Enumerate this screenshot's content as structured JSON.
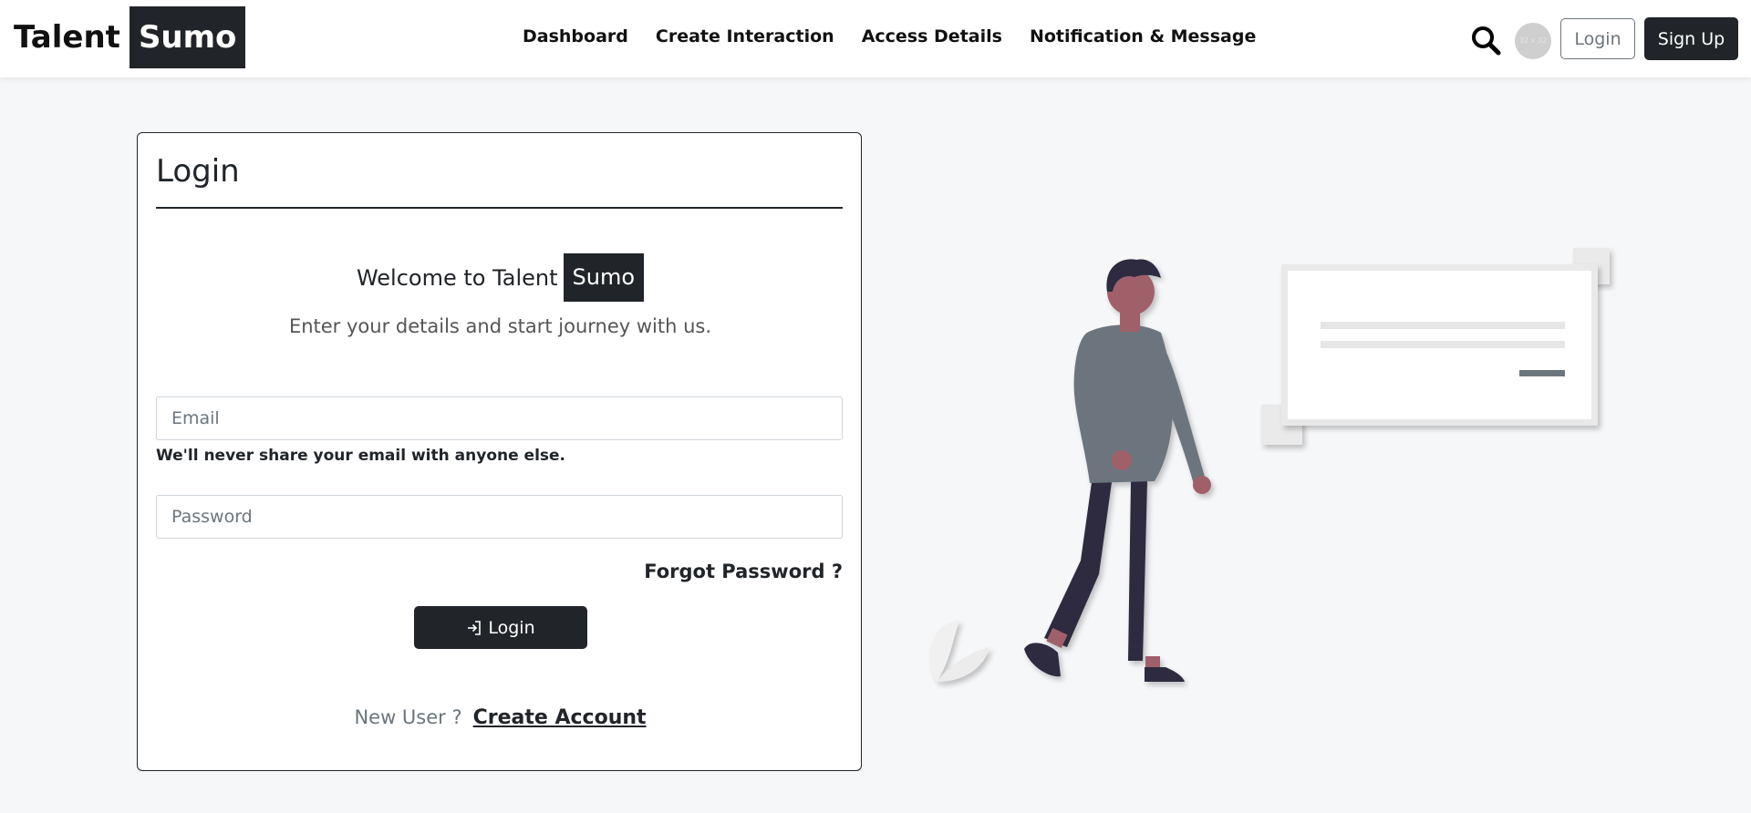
{
  "brand": {
    "part1": "Talent",
    "part2": "Sumo"
  },
  "nav": {
    "links": [
      "Dashboard",
      "Create Interaction",
      "Access Details",
      "Notification & Message"
    ],
    "avatar_text": "32 x 32",
    "login_label": "Login",
    "signup_label": "Sign Up"
  },
  "login": {
    "title": "Login",
    "welcome_prefix": "Welcome to Talent",
    "welcome_brand": "Sumo",
    "subtitle": "Enter your details and start journey with us.",
    "email_placeholder": "Email",
    "email_help": "We'll never share your email with anyone else.",
    "password_placeholder": "Password",
    "forgot_label": "Forgot Password ?",
    "submit_label": "Login",
    "new_user_label": "New User ?",
    "create_account_label": "Create Account"
  },
  "icons": {
    "search": "search-icon",
    "login": "login-arrow-icon"
  },
  "colors": {
    "dark": "#212529",
    "muted": "#6c757d",
    "background": "#f6f7f9"
  }
}
